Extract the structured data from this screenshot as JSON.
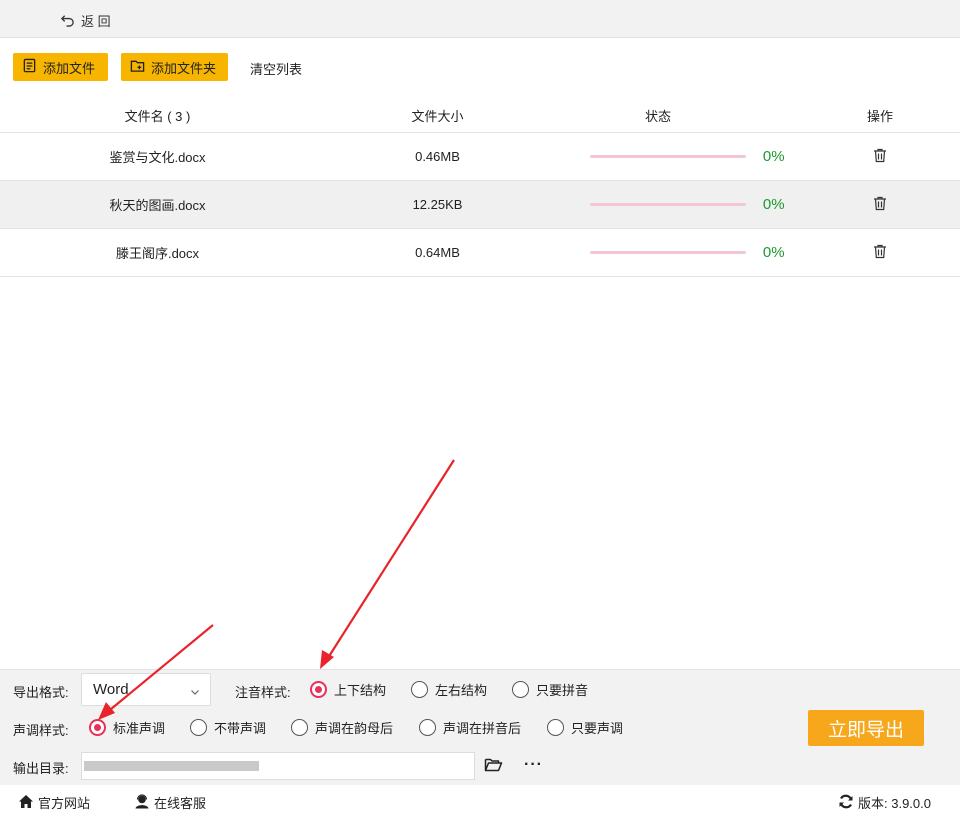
{
  "nav": {
    "back_label": "返 回"
  },
  "toolbar": {
    "add_file_label": "添加文件",
    "add_folder_label": "添加文件夹",
    "clear_label": "清空列表"
  },
  "table": {
    "headers": {
      "name": "文件名 ( 3 )",
      "size": "文件大小",
      "status": "状态",
      "action": "操作"
    },
    "rows": [
      {
        "name": "鉴赏与文化.docx",
        "size": "0.46MB",
        "percent": "0%",
        "progress": 0
      },
      {
        "name": "秋天的图画.docx",
        "size": "12.25KB",
        "percent": "0%",
        "progress": 0
      },
      {
        "name": "滕王阁序.docx",
        "size": "0.64MB",
        "percent": "0%",
        "progress": 0
      }
    ]
  },
  "options": {
    "export_format_label": "导出格式:",
    "export_format_value": "Word",
    "annotation_style_label": "注音样式:",
    "annotation_options": [
      "上下结构",
      "左右结构",
      "只要拼音"
    ],
    "annotation_selected": "上下结构",
    "tone_style_label": "声调样式:",
    "tone_options": [
      "标准声调",
      "不带声调",
      "声调在韵母后",
      "声调在拼音后",
      "只要声调"
    ],
    "tone_selected": "标准声调",
    "output_dir_label": "输出目录:",
    "more_label": "···",
    "export_button_label": "立即导出"
  },
  "statusbar": {
    "website_label": "官方网站",
    "support_label": "在线客服",
    "version_label": "版本: 3.9.0.0"
  },
  "colors": {
    "accent_yellow": "#f7b500",
    "export_orange": "#f7a71c",
    "radio_selected": "#e8315a",
    "percent_green": "#1a9a2e",
    "progress_track": "#f4c6d3",
    "annotation_arrow": "#e8232a"
  }
}
